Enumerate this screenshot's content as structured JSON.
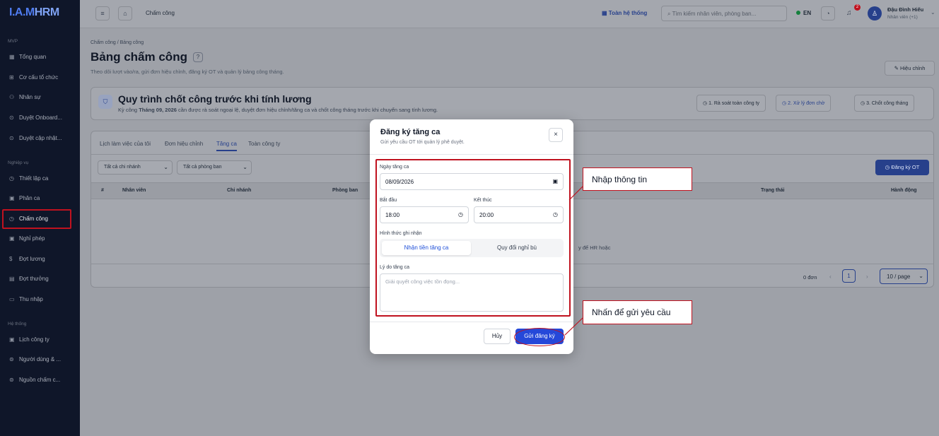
{
  "app": {
    "logo_main": "I.A.M",
    "logo_accent": "HRM"
  },
  "sidebar": {
    "sec_mvp": "MVP",
    "sec_ops": "Nghiệp vụ",
    "sec_sys": "Hệ thống",
    "items": [
      {
        "label": "Tổng quan",
        "icon": "dashboard-icon"
      },
      {
        "label": "Cơ cấu tổ chức",
        "icon": "org-icon"
      },
      {
        "label": "Nhân sự",
        "icon": "users-icon"
      },
      {
        "label": "Duyệt Onboard...",
        "icon": "check-icon"
      },
      {
        "label": "Duyệt cập nhật...",
        "icon": "check-icon"
      },
      {
        "label": "Thiết lập ca",
        "icon": "clock-icon"
      },
      {
        "label": "Phân ca",
        "icon": "calendar-icon"
      },
      {
        "label": "Chấm công",
        "icon": "clock-icon"
      },
      {
        "label": "Nghỉ phép",
        "icon": "calendar-icon"
      },
      {
        "label": "Đợt lương",
        "icon": "dollar-icon"
      },
      {
        "label": "Đợt thưởng",
        "icon": "gift-icon"
      },
      {
        "label": "Thu nhập",
        "icon": "wallet-icon"
      },
      {
        "label": "Lịch công ty",
        "icon": "calendar-icon"
      },
      {
        "label": "Người dùng & ...",
        "icon": "shield-icon"
      },
      {
        "label": "Nguồn chấm c...",
        "icon": "fingerprint-icon"
      }
    ]
  },
  "topbar": {
    "breadcrumb": "Chấm công",
    "system": "Toàn hệ thống",
    "search_placeholder": "Tìm kiếm nhân viên, phòng ban...",
    "lang": "EN",
    "notif_count": "2",
    "user_name": "Đậu Đình Hiếu",
    "user_role": "Nhân viên (+1)"
  },
  "page": {
    "breadcrumb": "Chấm công / Bảng công",
    "title": "Bảng chấm công",
    "subtitle": "Theo dõi lượt vào/ra, gửi đơn hiệu chỉnh, đăng ký OT và quản lý bảng công tháng.",
    "edit_button": "Hiệu chỉnh"
  },
  "process": {
    "title": "Quy trình chốt công trước khi tính lương",
    "sub_prefix": "Kỳ công ",
    "sub_period": "Tháng 09, 2026",
    "sub_suffix": " cần được rà soát ngoại lệ, duyệt đơn hiệu chỉnh/tăng ca và chốt công tháng trước khi chuyển sang tính lương.",
    "steps": [
      "1. Rà soát toàn công ty",
      "2. Xử lý đơn chờ",
      "3. Chốt công tháng"
    ]
  },
  "tabs": [
    "Lịch làm việc của tôi",
    "Đơn hiệu chỉnh",
    "Tăng ca",
    "Toàn công ty"
  ],
  "filters": {
    "branch": "Tất cả chi nhánh",
    "dept": "Tất cả phòng ban"
  },
  "ot_button": "Đăng ký OT",
  "table": {
    "headers": [
      "#",
      "Nhân viên",
      "Chi nhánh",
      "Phòng ban",
      "n",
      "Trạng thái",
      "Hành động"
    ],
    "empty_text": "y để HR hoặc"
  },
  "pagination": {
    "count": "0 đơn",
    "page": "1",
    "page_size": "10 / page"
  },
  "modal": {
    "title": "Đăng ký tăng ca",
    "subtitle": "Gửi yêu cầu OT tới quản lý phê duyệt.",
    "date_label": "Ngày tăng ca",
    "date_value": "08/09/2026",
    "start_label": "Bắt đầu",
    "start_value": "18:00",
    "end_label": "Kết thúc",
    "end_value": "20:00",
    "mode_label": "Hình thức ghi nhận",
    "mode_a": "Nhận tiền tăng ca",
    "mode_b": "Quy đổi nghỉ bù",
    "reason_label": "Lý do tăng ca",
    "reason_placeholder": "Giải quyết công việc tồn đọng...",
    "cancel": "Hủy",
    "submit": "Gửi đăng ký"
  },
  "callouts": {
    "info": "Nhập thông tin",
    "submit": "Nhấn để gửi yêu cầu"
  },
  "colors": {
    "accent": "#2548d9",
    "annotation": "#c0121f",
    "sidebar": "#0f1629"
  }
}
